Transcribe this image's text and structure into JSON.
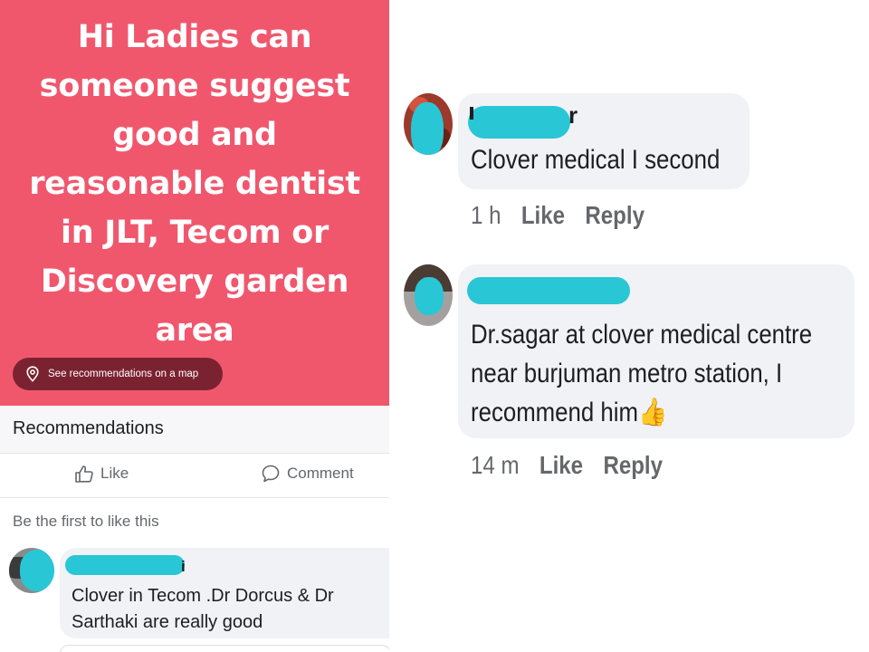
{
  "post": {
    "text": "Hi Ladies can someone suggest good and reasonable dentist in JLT, Tecom or Discovery garden area",
    "map_button_label": "See recommendations on a map",
    "background_color": "#f0576d"
  },
  "recommendations_title": "Recommendations",
  "actions": {
    "like_label": "Like",
    "comment_label": "Comment"
  },
  "first_like_text": "Be the first to like this",
  "left_comment": {
    "author_suffix": "i",
    "text": "Clover in Tecom .Dr Dorcus & Dr Sarthaki are really good"
  },
  "right_comments": [
    {
      "author_suffix": "r",
      "text": "Clover medical I second",
      "time": "1 h",
      "like_label": "Like",
      "reply_label": "Reply"
    },
    {
      "text_lines": [
        "Dr.sagar at clover medical centre",
        "near burjuman metro station, I",
        "recommend him"
      ],
      "emoji": "👍",
      "time": "14 m",
      "like_label": "Like",
      "reply_label": "Reply"
    }
  ],
  "colors": {
    "redaction": "#29c6d6",
    "bubble": "#f0f2f5",
    "meta_text": "#65676b"
  }
}
